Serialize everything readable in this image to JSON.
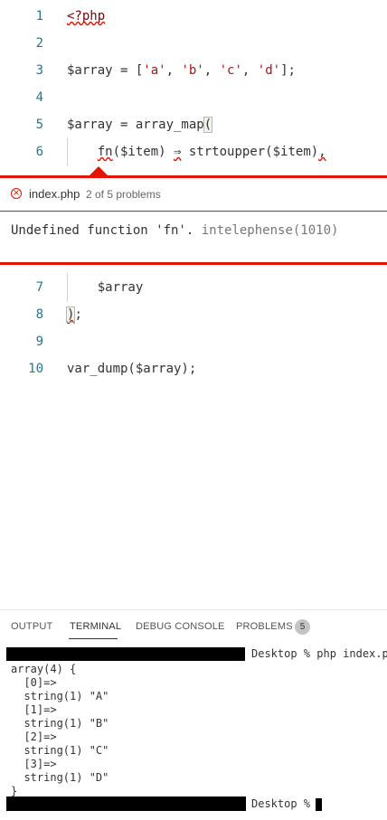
{
  "editor": {
    "lines": [
      {
        "num": "1",
        "parts": [
          {
            "t": "<?php",
            "c": "kw",
            "sq": true
          }
        ]
      },
      {
        "num": "2",
        "parts": [
          {
            "t": "",
            "c": ""
          }
        ]
      },
      {
        "num": "3",
        "parts": [
          {
            "t": "$array = [",
            "c": ""
          },
          {
            "t": "'a'",
            "c": "str"
          },
          {
            "t": ", ",
            "c": ""
          },
          {
            "t": "'b'",
            "c": "str"
          },
          {
            "t": ", ",
            "c": ""
          },
          {
            "t": "'c'",
            "c": "str"
          },
          {
            "t": ", ",
            "c": ""
          },
          {
            "t": "'d'",
            "c": "str"
          },
          {
            "t": "];",
            "c": ""
          }
        ]
      },
      {
        "num": "4",
        "parts": [
          {
            "t": "",
            "c": ""
          }
        ]
      },
      {
        "num": "5",
        "parts": [
          {
            "t": "$array = array_map",
            "c": ""
          },
          {
            "t": "(",
            "c": "bracket"
          }
        ]
      },
      {
        "num": "6",
        "parts": [
          {
            "t": "    ",
            "c": ""
          },
          {
            "t": "fn",
            "c": "",
            "sq": true
          },
          {
            "t": "($item) ",
            "c": ""
          },
          {
            "t": "⇒",
            "c": "",
            "sq": true
          },
          {
            "t": " strtoupper($item)",
            "c": ""
          },
          {
            "t": ",",
            "c": "",
            "sq": true
          }
        ]
      },
      {
        "num": "7",
        "parts": [
          {
            "t": "    $array",
            "c": ""
          }
        ]
      },
      {
        "num": "8",
        "parts": [
          {
            "t": ")",
            "c": "bracket",
            "sq": true
          },
          {
            "t": ";",
            "c": ""
          }
        ]
      },
      {
        "num": "9",
        "parts": [
          {
            "t": "",
            "c": ""
          }
        ]
      },
      {
        "num": "10",
        "parts": [
          {
            "t": "var_dump($array);",
            "c": ""
          }
        ]
      }
    ]
  },
  "peek": {
    "filename": "index.php",
    "count": "2 of 5 problems",
    "message": "Undefined function 'fn'.",
    "source": "intelephense(1010)"
  },
  "panel": {
    "tabs": [
      "OUTPUT",
      "TERMINAL",
      "DEBUG CONSOLE",
      "PROBLEMS"
    ],
    "problems_count": "5"
  },
  "terminal": {
    "prompt1": "Desktop % php index.php",
    "output": [
      "array(4) {",
      "  [0]=>",
      "  string(1) \"A\"",
      "  [1]=>",
      "  string(1) \"B\"",
      "  [2]=>",
      "  string(1) \"C\"",
      "  [3]=>",
      "  string(1) \"D\"",
      "}"
    ],
    "prompt2": "Desktop % "
  },
  "colors": {
    "error": "#e51400",
    "line_number": "#237893",
    "string": "#a31515",
    "keyword": "#800000"
  },
  "icons": {
    "peek_error": "error-circle-icon"
  }
}
